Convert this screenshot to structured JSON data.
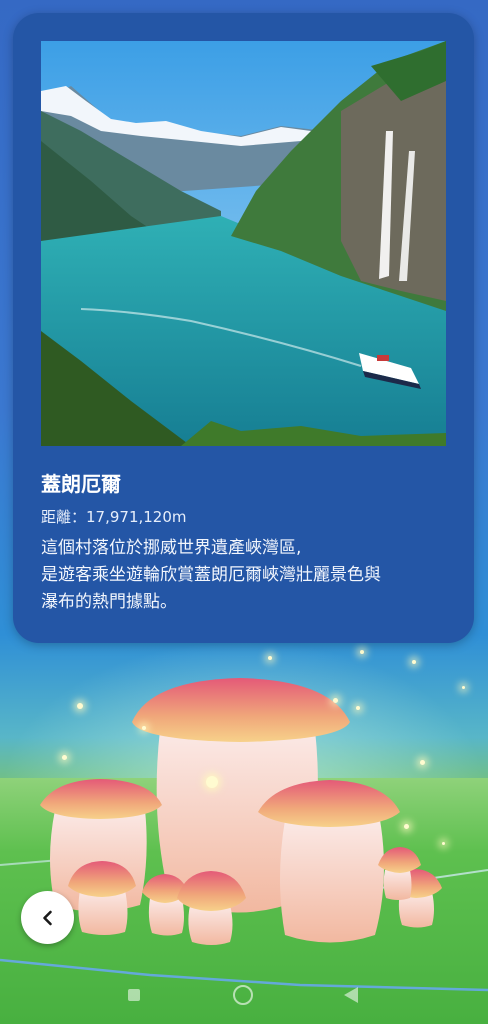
{
  "location": {
    "name": "蓋朗厄爾",
    "distance": "距離：17,971,120m",
    "description_lines": [
      "這個村落位於挪威世界遺產峽灣區,",
      "是遊客乘坐遊輪欣賞蓋朗厄爾峽灣壯麗景色與",
      "瀑布的熱門據點。"
    ]
  },
  "icons": {
    "back": "chevron-left-icon",
    "nav_recents": "square-icon",
    "nav_home": "circle-icon",
    "nav_back": "triangle-back-icon"
  },
  "colors": {
    "card": "#2456a6",
    "background_sky": "#3569c4",
    "field": "#5ec04f"
  }
}
